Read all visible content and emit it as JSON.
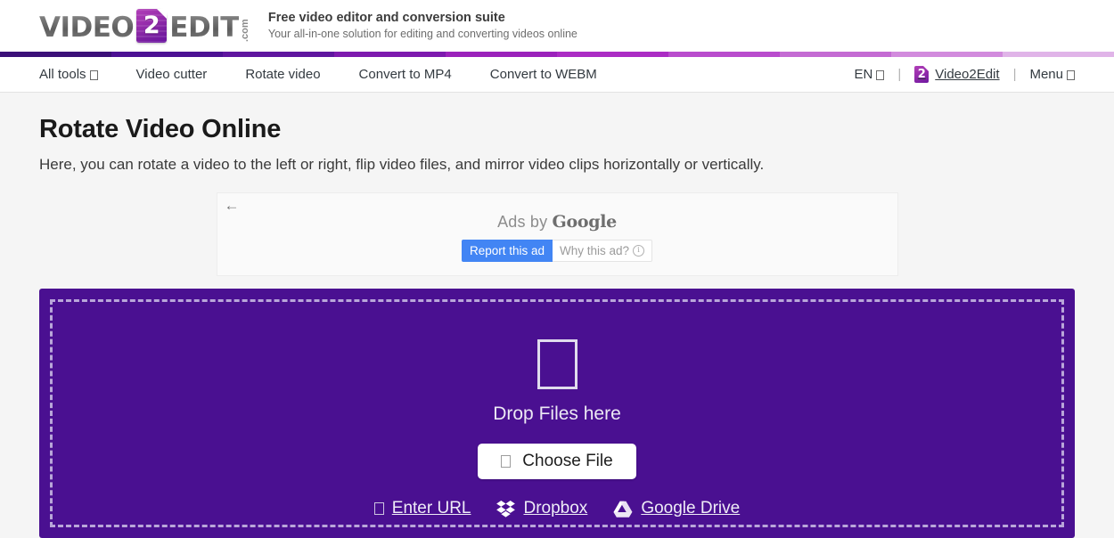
{
  "header": {
    "logo": {
      "word1": "VIDEO",
      "badge": "2",
      "word2": "EDIT",
      "dotcom": ".com"
    },
    "tagline_main": "Free video editor and conversion suite",
    "tagline_sub": "Your all-in-one solution for editing and converting videos online"
  },
  "gradient_strip": {
    "colors": [
      "#3b1078",
      "#4c1193",
      "#5f169f",
      "#7d1aae",
      "#9b22bb",
      "#ab2cc4",
      "#b94ccd",
      "#c46bd3",
      "#d28bdd",
      "#e0b4e8"
    ]
  },
  "nav": {
    "left_items": [
      {
        "label": "All tools",
        "has_caret": true
      },
      {
        "label": "Video cutter",
        "has_caret": false
      },
      {
        "label": "Rotate video",
        "has_caret": false
      },
      {
        "label": "Convert to MP4",
        "has_caret": false
      },
      {
        "label": "Convert to WEBM",
        "has_caret": false
      }
    ],
    "language": "EN",
    "separator": "|",
    "account": "Video2Edit",
    "menu": "Menu"
  },
  "main": {
    "title": "Rotate Video Online",
    "subtitle": "Here, you can rotate a video to the left or right, flip video files, and mirror video clips horizontally or vertically."
  },
  "ad": {
    "back_arrow": "←",
    "label_prefix": "Ads by ",
    "label_brand": "Google",
    "report_label": "Report this ad",
    "why_label": "Why this ad?",
    "info_glyph": "i"
  },
  "dropzone": {
    "title": "Drop Files here",
    "choose_file": "Choose File",
    "sources": [
      {
        "label": "Enter URL",
        "icon": "link-icon"
      },
      {
        "label": "Dropbox",
        "icon": "dropbox-icon"
      },
      {
        "label": "Google Drive",
        "icon": "google-drive-icon"
      }
    ],
    "background_color": "#4a1091",
    "border_color": "#b9a6d9"
  }
}
